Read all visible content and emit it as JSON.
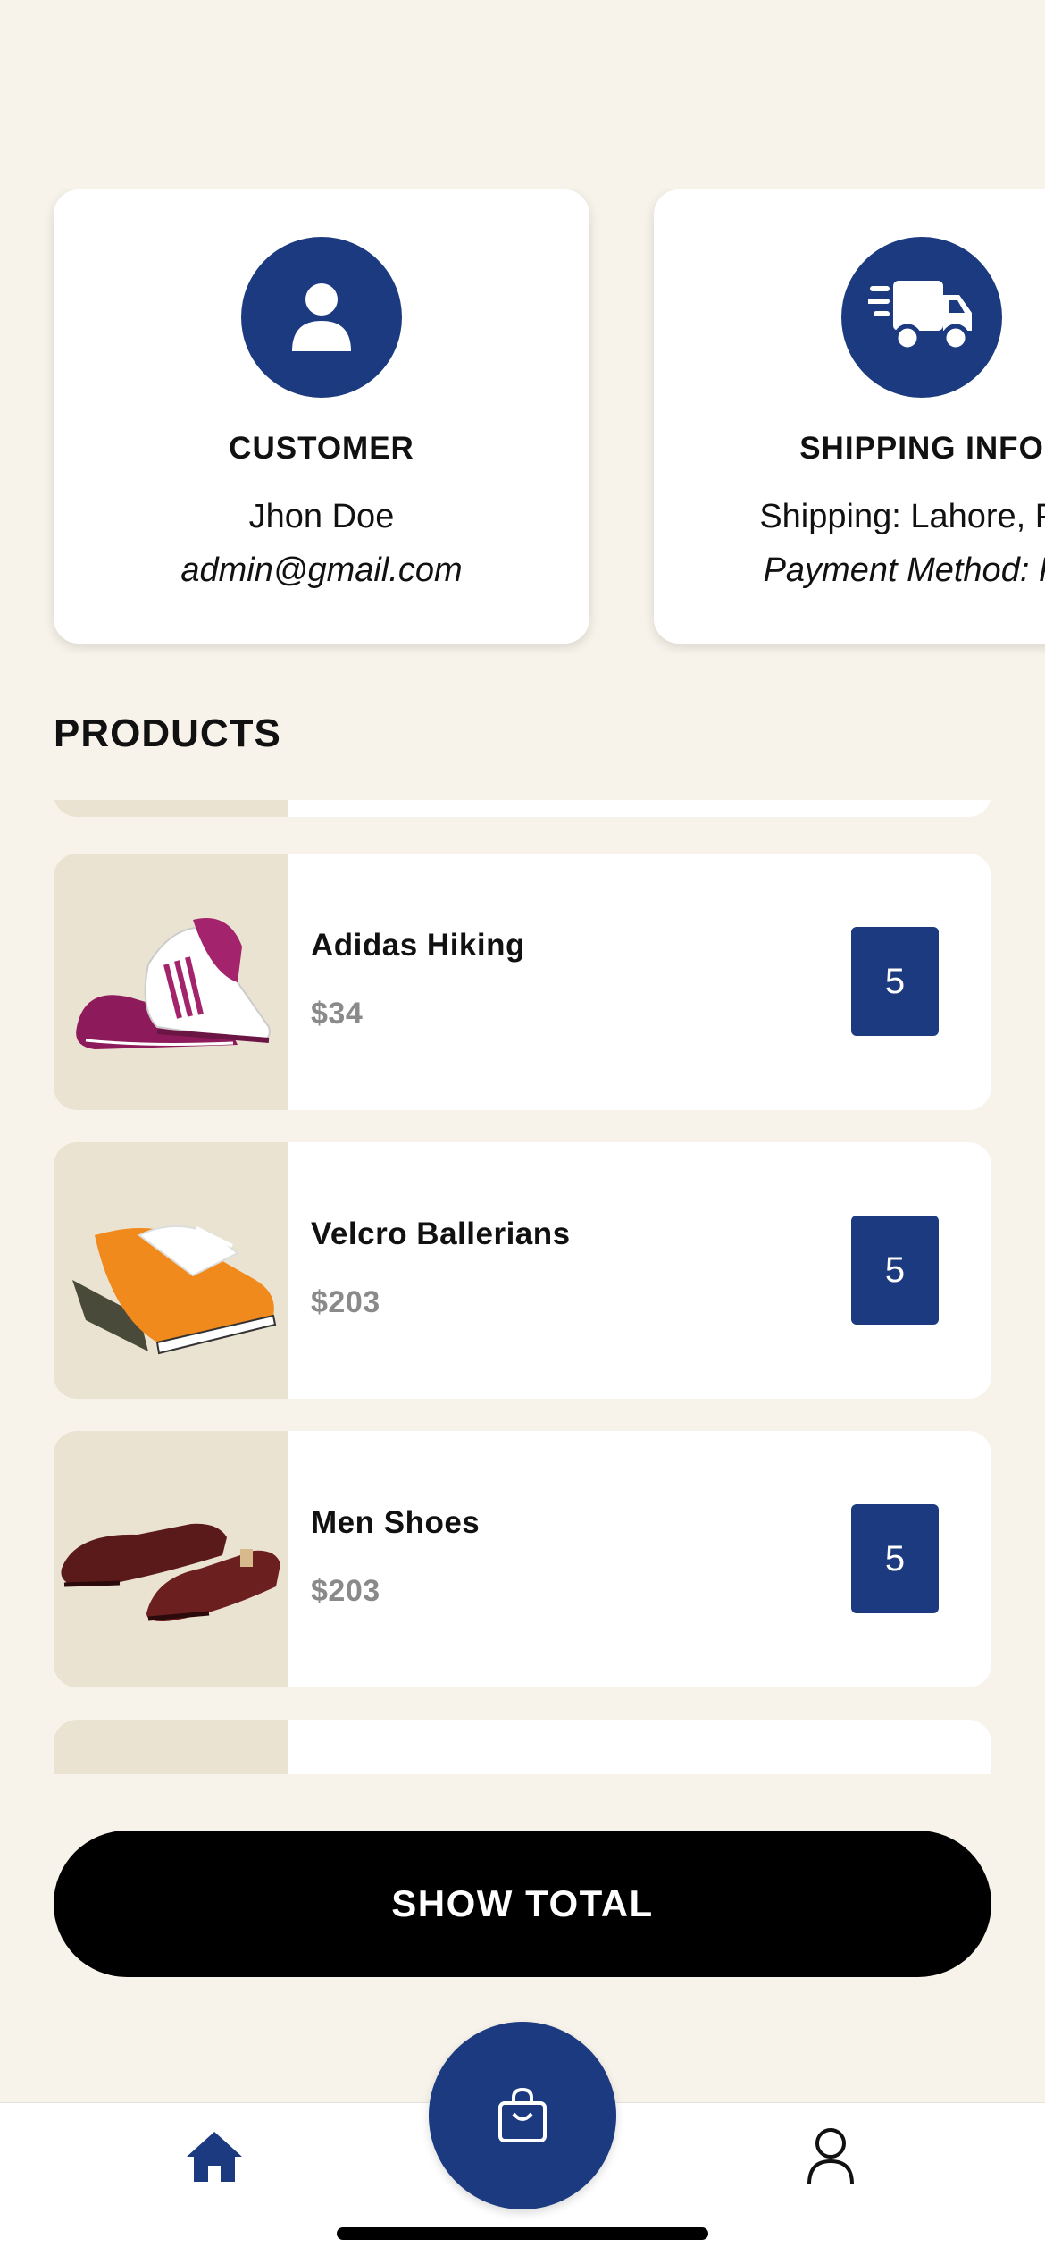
{
  "customer_card": {
    "title": "CUSTOMER",
    "name": "Jhon Doe",
    "email": "admin@gmail.com",
    "icon": "user-icon"
  },
  "shipping_card": {
    "title": "SHIPPING INFO",
    "shipping": "Shipping: Lahore, Pal",
    "payment": "Payment Method: Pa",
    "icon": "truck-icon"
  },
  "products_title": "PRODUCTS",
  "products": [
    {
      "name": "Adidas Hiking",
      "price": "$34",
      "qty": "5"
    },
    {
      "name": "Velcro Ballerians",
      "price": "$203",
      "qty": "5"
    },
    {
      "name": "Men Shoes",
      "price": "$203",
      "qty": "5"
    }
  ],
  "show_total_label": "SHOW TOTAL",
  "tabbar": {
    "home_icon": "home-icon",
    "center_icon": "shopping-bag-icon",
    "profile_icon": "person-icon"
  },
  "colors": {
    "primary": "#1c3a7f",
    "background": "#f7f3ea",
    "thumb_bg": "#ebe3d2",
    "price_gray": "#8a8a8a"
  }
}
